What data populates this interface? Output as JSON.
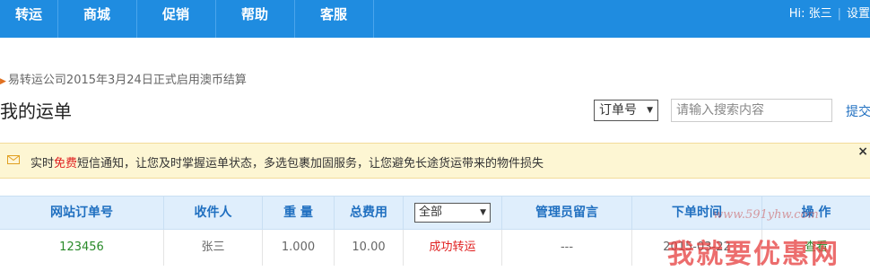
{
  "nav": {
    "items": [
      "转运",
      "商城",
      "促销",
      "帮助",
      "客服"
    ],
    "greeting": "Hi: 张三",
    "settings": "设置"
  },
  "notice": "易转运公司2015年3月24日正式启用澳币结算",
  "page_title": "我的运单",
  "search": {
    "type_selected": "订单号",
    "placeholder": "请输入搜索内容",
    "submit": "提交"
  },
  "info_bar": {
    "prefix": "实时",
    "highlight": "免费",
    "suffix": "短信通知，让您及时掌握运单状态，多选包裹加固服务，让您避免长途货运带来的物件损失",
    "close": "×"
  },
  "table": {
    "headers": [
      "网站订单号",
      "收件人",
      "重 量",
      "总费用",
      "",
      "管理员留言",
      "下单时间",
      "操 作"
    ],
    "status_filter": "全部",
    "rows": [
      {
        "order_no": "123456",
        "recipient": "张三",
        "weight": "1.000",
        "total": "10.00",
        "status": "成功转运",
        "admin_note": "---",
        "date": "2015-03-22",
        "action": "查看"
      }
    ]
  },
  "watermark": {
    "url": "www.591yhw.com",
    "text": "我就要优惠网"
  },
  "colors": {
    "nav_bg": "#1f8ce0",
    "header_text": "#1f6fc0",
    "info_bg": "#fdf6d3",
    "highlight": "#e02020",
    "order_green": "#2a8a2a"
  }
}
